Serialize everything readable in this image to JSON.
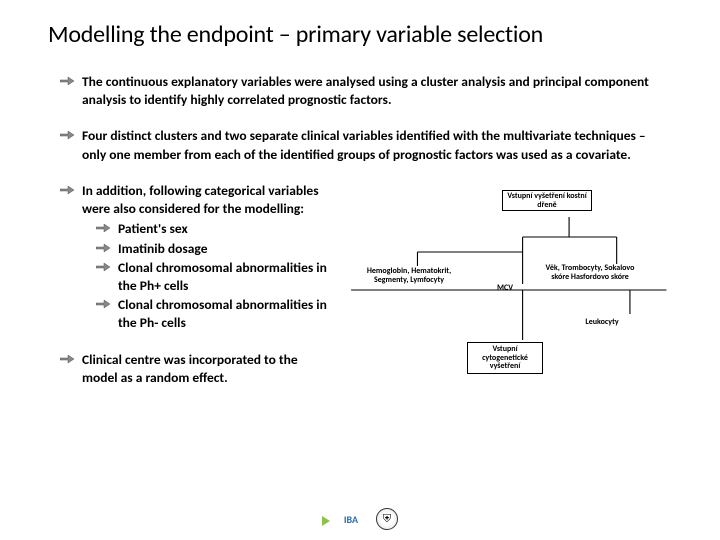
{
  "title": "Modelling the endpoint – primary variable selection",
  "bullets": {
    "b1": "The continuous explanatory variables were analysed using a cluster analysis and principal component analysis to identify highly correlated prognostic factors.",
    "b2": "Four distinct clusters and two separate clinical variables identified with the multivariate techniques – only one member from each of the identified groups of prognostic factors was used as a covariate.",
    "b3_lead": "In addition, following categorical variables were also considered for the modelling:",
    "b3_items": {
      "s1": "Patient's sex",
      "s2": "Imatinib dosage",
      "s3": "Clonal chromosomal abnormalities in the Ph+ cells",
      "s4": "Clonal chromosomal abnormalities in the Ph- cells"
    },
    "b4": "Clinical centre was incorporated to the model as a random effect."
  },
  "dendrogram": {
    "top": "Vstupní vyšetření kostní dřeně",
    "hemo": "Hemoglobin, Hematokrit, Segmenty, Lymfocyty",
    "mcv": "MCV",
    "vek": "Věk, Trombocyty, Sokalovo skóre Hasfordovo skóre",
    "leuk": "Leukocyty",
    "cyto": "Vstupní cytogenetické vyšetření"
  },
  "footer": {
    "iba": "IBA",
    "uni_glyph": "⛨"
  }
}
